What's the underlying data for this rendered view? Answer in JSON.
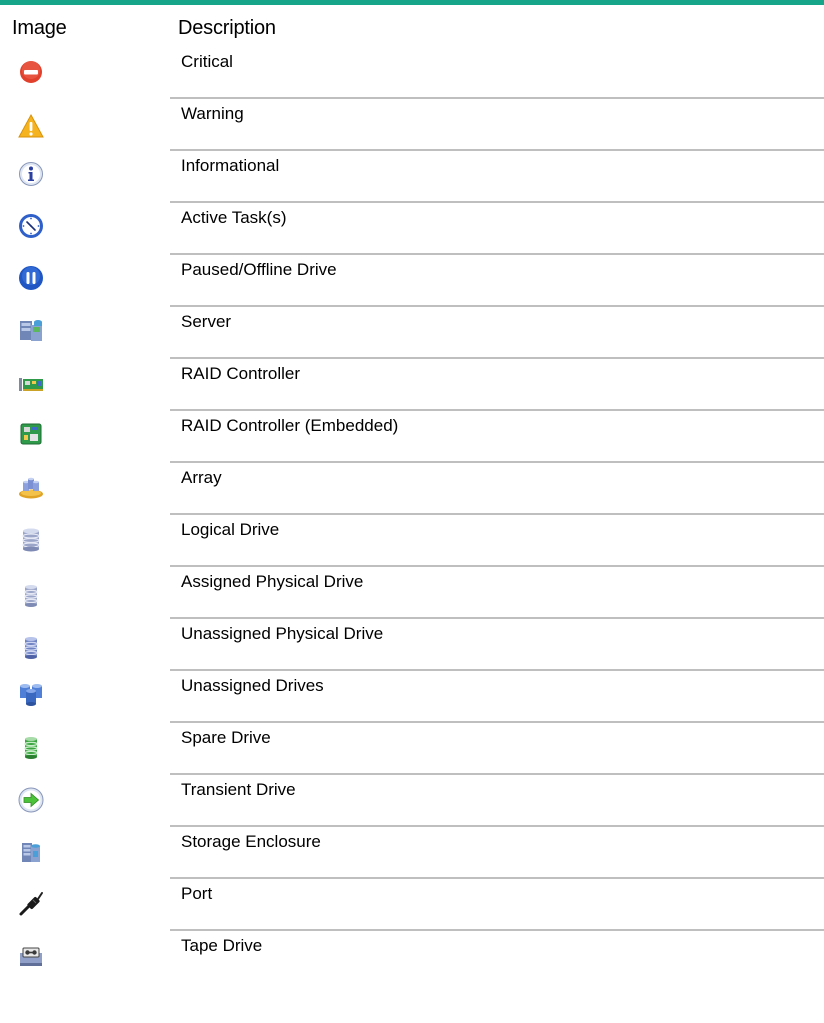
{
  "header": {
    "image_label": "Image",
    "description_label": "Description"
  },
  "colors": {
    "top_rule": "#17a589",
    "row_rule": "#bfbfbf"
  },
  "rows": [
    {
      "icon": "critical-icon",
      "description": "Critical"
    },
    {
      "icon": "warning-icon",
      "description": "Warning"
    },
    {
      "icon": "informational-icon",
      "description": "Informational"
    },
    {
      "icon": "active-task-icon",
      "description": "Active Task(s)"
    },
    {
      "icon": "paused-offline-drive-icon",
      "description": "Paused/Offline Drive"
    },
    {
      "icon": "server-icon",
      "description": "Server"
    },
    {
      "icon": "raid-controller-icon",
      "description": "RAID Controller"
    },
    {
      "icon": "raid-controller-embedded-icon",
      "description": "RAID Controller (Embedded)"
    },
    {
      "icon": "array-icon",
      "description": "Array"
    },
    {
      "icon": "logical-drive-icon",
      "description": "Logical Drive"
    },
    {
      "icon": "assigned-physical-drive-icon",
      "description": "Assigned Physical Drive"
    },
    {
      "icon": "unassigned-physical-drive-icon",
      "description": "Unassigned Physical Drive"
    },
    {
      "icon": "unassigned-drives-icon",
      "description": "Unassigned Drives"
    },
    {
      "icon": "spare-drive-icon",
      "description": "Spare Drive"
    },
    {
      "icon": "transient-drive-icon",
      "description": "Transient Drive"
    },
    {
      "icon": "storage-enclosure-icon",
      "description": "Storage Enclosure"
    },
    {
      "icon": "port-icon",
      "description": "Port"
    },
    {
      "icon": "tape-drive-icon",
      "description": "Tape Drive"
    }
  ]
}
